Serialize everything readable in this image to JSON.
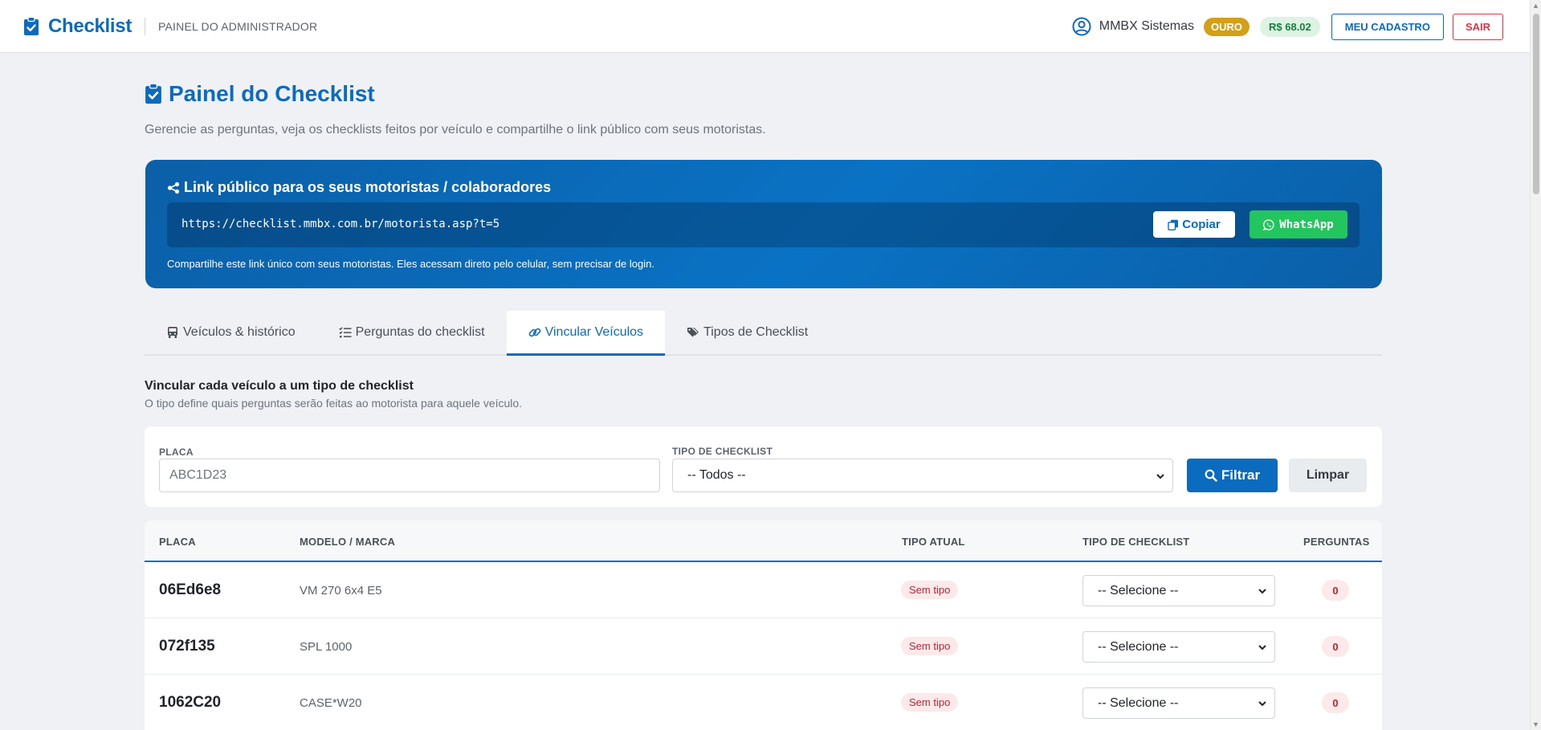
{
  "header": {
    "brand": "Checklist",
    "subtitle": "PAINEL DO ADMINISTRADOR",
    "user_name": "MMBX Sistemas",
    "plan_badge": "OURO",
    "balance": "R$ 68.02",
    "profile_button": "MEU CADASTRO",
    "logout_button": "SAIR"
  },
  "page": {
    "title": "Painel do Checklist",
    "description": "Gerencie as perguntas, veja os checklists feitos por veículo e compartilhe o link público com seus motoristas."
  },
  "link_card": {
    "title": "Link público para os seus motoristas / colaboradores",
    "url": "https://checklist.mmbx.com.br/motorista.asp?t=5",
    "copy_button": "Copiar",
    "whatsapp_button": "WhatsApp",
    "note": "Compartilhe este link único com seus motoristas. Eles acessam direto pelo celular, sem precisar de login."
  },
  "tabs": [
    {
      "label": "Veículos & histórico",
      "icon": "truck-icon"
    },
    {
      "label": "Perguntas do checklist",
      "icon": "list-check-icon"
    },
    {
      "label": "Vincular Veículos",
      "icon": "link-icon",
      "active": true
    },
    {
      "label": "Tipos de Checklist",
      "icon": "tags-icon"
    }
  ],
  "section": {
    "title": "Vincular cada veículo a um tipo de checklist",
    "subtitle": "O tipo define quais perguntas serão feitas ao motorista para aquele veículo."
  },
  "filters": {
    "placa_label": "PLACA",
    "placa_placeholder": "ABC1D23",
    "tipo_label": "TIPO DE CHECKLIST",
    "tipo_value": "-- Todos --",
    "filter_button": "Filtrar",
    "clear_button": "Limpar"
  },
  "table": {
    "columns": [
      "PLACA",
      "MODELO / MARCA",
      "TIPO ATUAL",
      "TIPO DE CHECKLIST",
      "PERGUNTAS"
    ],
    "rows": [
      {
        "placa": "06Ed6e8",
        "modelo": "VM 270 6x4 E5",
        "tipo_atual": "Sem tipo",
        "tipo_select": "-- Selecione --",
        "perguntas": "0"
      },
      {
        "placa": "072f135",
        "modelo": "SPL 1000",
        "tipo_atual": "Sem tipo",
        "tipo_select": "-- Selecione --",
        "perguntas": "0"
      },
      {
        "placa": "1062C20",
        "modelo": "CASE*W20",
        "tipo_atual": "Sem tipo",
        "tipo_select": "-- Selecione --",
        "perguntas": "0"
      }
    ]
  },
  "colors": {
    "primary": "#0b6bbf",
    "danger": "#dc3545",
    "whatsapp": "#22c55e",
    "gold": "#d4a017",
    "page_bg": "#f0f1f5"
  }
}
